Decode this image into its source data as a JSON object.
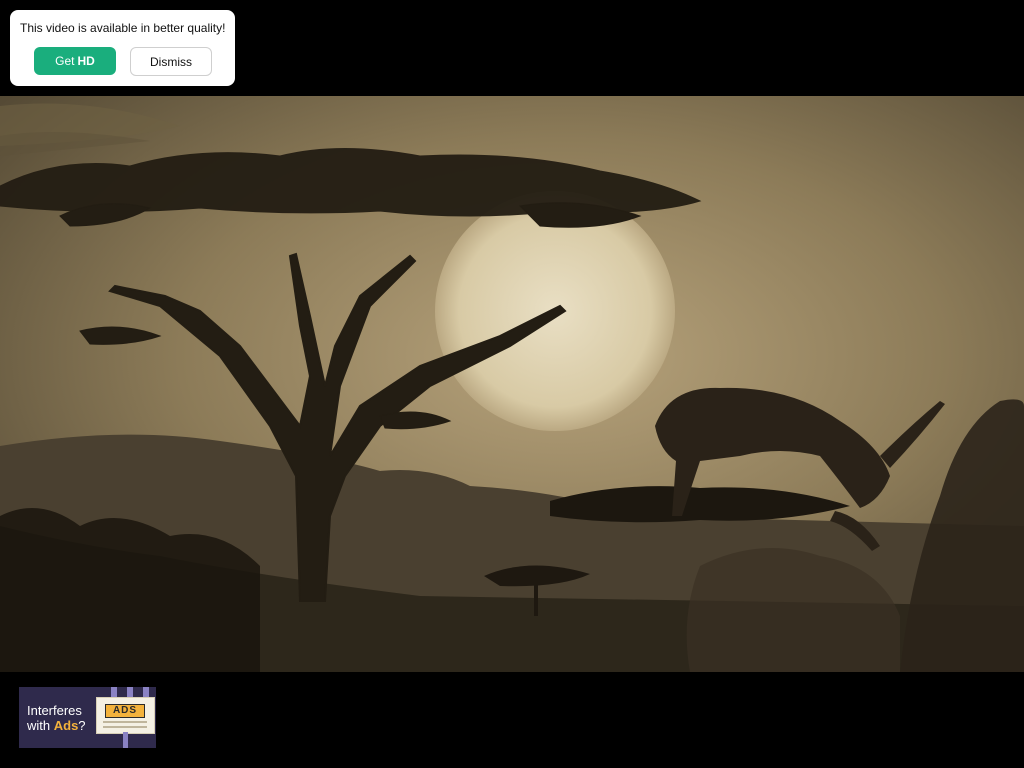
{
  "toast": {
    "message": "This video is available in better quality!",
    "get_label": "Get",
    "get_label_hd": "HD",
    "dismiss_label": "Dismiss"
  },
  "video": {
    "scene": "sepia savanna sunset with acacia tree and grazing antelope"
  },
  "ad": {
    "line1": "Interferes",
    "line2_prefix": "with ",
    "line2_accent": "Ads",
    "line2_suffix": "?",
    "badge": "ADS"
  },
  "colors": {
    "page_bg": "#000000",
    "primary_button": "#1aae7d",
    "ad_bg": "#2f2a4c",
    "ad_accent": "#f3b23c"
  }
}
